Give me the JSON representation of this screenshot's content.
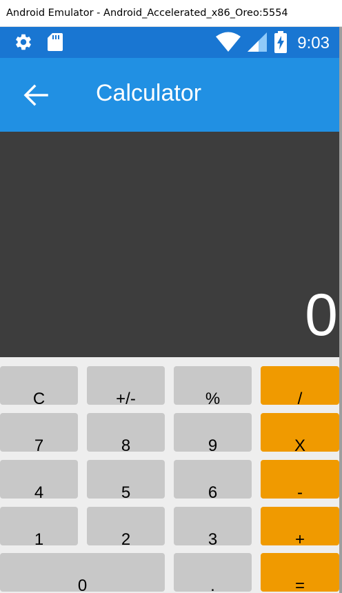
{
  "window": {
    "title": "Android Emulator - Android_Accelerated_x86_Oreo:5554"
  },
  "status_bar": {
    "icons_left": [
      "gear-icon",
      "sd-card-icon"
    ],
    "icons_right": [
      "wifi-icon",
      "cell-signal-icon",
      "battery-charging-icon"
    ],
    "time": "9:03",
    "color": "#1976d2"
  },
  "app_bar": {
    "back_icon": "arrow-back-icon",
    "title": "Calculator",
    "color": "#2190e3"
  },
  "display": {
    "value": "0",
    "background": "#3d3d3d"
  },
  "keypad": {
    "background": "#eeeeee",
    "function_key_color": "#c8c8c8",
    "operator_key_color": "#f09a00",
    "rows": [
      [
        {
          "label": "C",
          "type": "function"
        },
        {
          "label": "+/-",
          "type": "function"
        },
        {
          "label": "%",
          "type": "function"
        },
        {
          "label": "/",
          "type": "operator"
        }
      ],
      [
        {
          "label": "7",
          "type": "function"
        },
        {
          "label": "8",
          "type": "function"
        },
        {
          "label": "9",
          "type": "function"
        },
        {
          "label": "X",
          "type": "operator"
        }
      ],
      [
        {
          "label": "4",
          "type": "function"
        },
        {
          "label": "5",
          "type": "function"
        },
        {
          "label": "6",
          "type": "function"
        },
        {
          "label": "-",
          "type": "operator"
        }
      ],
      [
        {
          "label": "1",
          "type": "function"
        },
        {
          "label": "2",
          "type": "function"
        },
        {
          "label": "3",
          "type": "function"
        },
        {
          "label": "+",
          "type": "operator"
        }
      ],
      [
        {
          "label": "0",
          "type": "function"
        },
        {
          "label": ".",
          "type": "function"
        },
        {
          "label": "=",
          "type": "operator"
        }
      ]
    ]
  }
}
